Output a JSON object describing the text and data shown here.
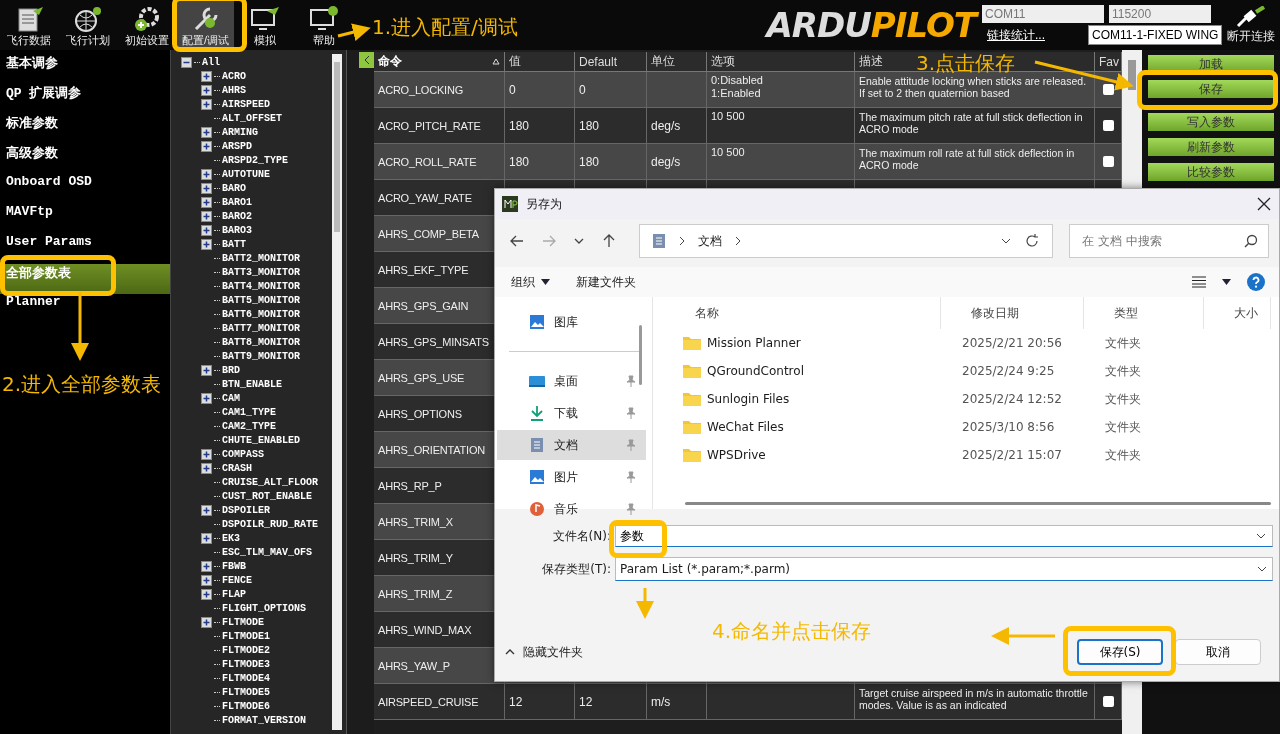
{
  "toolbar": {
    "items": [
      {
        "label": "飞行数据",
        "selected": false
      },
      {
        "label": "飞行计划",
        "selected": false
      },
      {
        "label": "初始设置",
        "selected": false
      },
      {
        "label": "配置/调试",
        "selected": true
      },
      {
        "label": "模拟",
        "selected": false
      },
      {
        "label": "帮助",
        "selected": false
      }
    ]
  },
  "logo": {
    "part_1": "ARDU",
    "part_2": "PILOT"
  },
  "connection": {
    "port": "COM11",
    "baud": "115200",
    "stats_link": "链接统计...",
    "vehicle": "COM11-1-FIXED WING",
    "disconnect": "断开连接"
  },
  "sidebar": {
    "items": [
      {
        "label": "基本调参",
        "selected": false
      },
      {
        "label": "QP 扩展调参",
        "selected": false
      },
      {
        "label": "标准参数",
        "selected": false
      },
      {
        "label": "高级参数",
        "selected": false
      },
      {
        "label": "Onboard OSD",
        "selected": false
      },
      {
        "label": "MAVFtp",
        "selected": false
      },
      {
        "label": "User Params",
        "selected": false
      },
      {
        "label": "全部参数表",
        "selected": true
      },
      {
        "label": "Planner",
        "selected": false
      }
    ]
  },
  "tree": {
    "label": "All",
    "kind": "group",
    "expanded": true,
    "children": [
      {
        "label": "ACRO",
        "kind": "group",
        "expanded": false
      },
      {
        "label": "AHRS",
        "kind": "group",
        "expanded": false
      },
      {
        "label": "AIRSPEED",
        "kind": "group",
        "expanded": false
      },
      {
        "label": "ALT_OFFSET",
        "kind": "leaf"
      },
      {
        "label": "ARMING",
        "kind": "group",
        "expanded": false
      },
      {
        "label": "ARSPD",
        "kind": "group",
        "expanded": false
      },
      {
        "label": "ARSPD2_TYPE",
        "kind": "leaf"
      },
      {
        "label": "AUTOTUNE",
        "kind": "group",
        "expanded": false
      },
      {
        "label": "BARO",
        "kind": "group",
        "expanded": false
      },
      {
        "label": "BARO1",
        "kind": "group",
        "expanded": false
      },
      {
        "label": "BARO2",
        "kind": "group",
        "expanded": false
      },
      {
        "label": "BARO3",
        "kind": "group",
        "expanded": false
      },
      {
        "label": "BATT",
        "kind": "group",
        "expanded": false
      },
      {
        "label": "BATT2_MONITOR",
        "kind": "leaf"
      },
      {
        "label": "BATT3_MONITOR",
        "kind": "leaf"
      },
      {
        "label": "BATT4_MONITOR",
        "kind": "leaf"
      },
      {
        "label": "BATT5_MONITOR",
        "kind": "leaf"
      },
      {
        "label": "BATT6_MONITOR",
        "kind": "leaf"
      },
      {
        "label": "BATT7_MONITOR",
        "kind": "leaf"
      },
      {
        "label": "BATT8_MONITOR",
        "kind": "leaf"
      },
      {
        "label": "BATT9_MONITOR",
        "kind": "leaf"
      },
      {
        "label": "BRD",
        "kind": "group",
        "expanded": false
      },
      {
        "label": "BTN_ENABLE",
        "kind": "leaf"
      },
      {
        "label": "CAM",
        "kind": "group",
        "expanded": false
      },
      {
        "label": "CAM1_TYPE",
        "kind": "leaf"
      },
      {
        "label": "CAM2_TYPE",
        "kind": "leaf"
      },
      {
        "label": "CHUTE_ENABLED",
        "kind": "leaf"
      },
      {
        "label": "COMPASS",
        "kind": "group",
        "expanded": false
      },
      {
        "label": "CRASH",
        "kind": "group",
        "expanded": false
      },
      {
        "label": "CRUISE_ALT_FLOOR",
        "kind": "leaf"
      },
      {
        "label": "CUST_ROT_ENABLE",
        "kind": "leaf"
      },
      {
        "label": "DSPOILER",
        "kind": "group",
        "expanded": false
      },
      {
        "label": "DSPOILR_RUD_RATE",
        "kind": "leaf"
      },
      {
        "label": "EK3",
        "kind": "group",
        "expanded": false
      },
      {
        "label": "ESC_TLM_MAV_OFS",
        "kind": "leaf"
      },
      {
        "label": "FBWB",
        "kind": "group",
        "expanded": false
      },
      {
        "label": "FENCE",
        "kind": "group",
        "expanded": false
      },
      {
        "label": "FLAP",
        "kind": "group",
        "expanded": false
      },
      {
        "label": "FLIGHT_OPTIONS",
        "kind": "leaf"
      },
      {
        "label": "FLTMODE",
        "kind": "group",
        "expanded": false
      },
      {
        "label": "FLTMODE1",
        "kind": "leaf"
      },
      {
        "label": "FLTMODE2",
        "kind": "leaf"
      },
      {
        "label": "FLTMODE3",
        "kind": "leaf"
      },
      {
        "label": "FLTMODE4",
        "kind": "leaf"
      },
      {
        "label": "FLTMODE5",
        "kind": "leaf"
      },
      {
        "label": "FLTMODE6",
        "kind": "leaf"
      },
      {
        "label": "FORMAT_VERSION",
        "kind": "leaf"
      }
    ]
  },
  "table": {
    "columns": [
      {
        "label": "命令",
        "sorted": true
      },
      {
        "label": "值",
        "sorted": false
      },
      {
        "label": "Default",
        "sorted": false
      },
      {
        "label": "单位",
        "sorted": false
      },
      {
        "label": "选项",
        "sorted": false
      },
      {
        "label": "描述",
        "sorted": false
      },
      {
        "label": "Fav",
        "sorted": false
      }
    ],
    "rows": [
      {
        "command": "ACRO_LOCKING",
        "value": "0",
        "default": "0",
        "options": [
          "0:Disabled",
          "1:Enabled"
        ],
        "description": "Enable attitude locking when sticks are released. If set to 2 then quaternion based",
        "fav": false
      },
      {
        "command": "ACRO_PITCH_RATE",
        "value": "180",
        "default": "180",
        "unit": "deg/s",
        "options": [
          "10 500"
        ],
        "description": "The maximum pitch rate at full stick deflection in ACRO mode",
        "fav": false
      },
      {
        "command": "ACRO_ROLL_RATE",
        "value": "180",
        "default": "180",
        "unit": "deg/s",
        "options": [
          "10 500"
        ],
        "description": "The maximum roll rate at full stick deflection in ACRO mode",
        "fav": false
      },
      {
        "command": "ACRO_YAW_RATE"
      },
      {
        "command": "AHRS_COMP_BETA"
      },
      {
        "command": "AHRS_EKF_TYPE"
      },
      {
        "command": "AHRS_GPS_GAIN"
      },
      {
        "command": "AHRS_GPS_MINSATS"
      },
      {
        "command": "AHRS_GPS_USE"
      },
      {
        "command": "AHRS_OPTIONS"
      },
      {
        "command": "AHRS_ORIENTATION"
      },
      {
        "command": "AHRS_RP_P"
      },
      {
        "command": "AHRS_TRIM_X"
      },
      {
        "command": "AHRS_TRIM_Y"
      },
      {
        "command": "AHRS_TRIM_Z"
      },
      {
        "command": "AHRS_WIND_MAX"
      },
      {
        "command": "AHRS_YAW_P"
      },
      {
        "command": "AIRSPEED_CRUISE",
        "value": "12",
        "default": "12",
        "unit": "m/s",
        "description": "Target cruise airspeed in m/s in automatic throttle modes. Value is as an indicated",
        "fav": false
      }
    ]
  },
  "actions": {
    "buttons": [
      "加载",
      "保存",
      "写入参数",
      "刷新参数",
      "比较参数"
    ]
  },
  "dialog": {
    "title": "另存为",
    "path": "文档",
    "search": {
      "placeholder": "在 文档 中搜索"
    },
    "toolbar": {
      "organize": "组织",
      "new_folder": "新建文件夹"
    },
    "nav_items": [
      {
        "label": "图库",
        "pinned": false,
        "selected": false
      },
      {
        "label": "桌面",
        "pinned": true,
        "selected": false
      },
      {
        "label": "下载",
        "pinned": true,
        "selected": false
      },
      {
        "label": "文档",
        "pinned": true,
        "selected": true
      },
      {
        "label": "图片",
        "pinned": true,
        "selected": false
      },
      {
        "label": "音乐",
        "pinned": true,
        "selected": false
      }
    ],
    "columns": [
      "名称",
      "修改日期",
      "类型",
      "大小"
    ],
    "files": [
      {
        "name": "Mission Planner",
        "modified": "2025/2/21 20:56",
        "type": "文件夹"
      },
      {
        "name": "QGroundControl",
        "modified": "2025/2/24 9:25",
        "type": "文件夹"
      },
      {
        "name": "Sunlogin Files",
        "modified": "2025/2/24 12:52",
        "type": "文件夹"
      },
      {
        "name": "WeChat Files",
        "modified": "2025/3/10 8:56",
        "type": "文件夹"
      },
      {
        "name": "WPSDrive",
        "modified": "2025/2/21 15:07",
        "type": "文件夹"
      }
    ],
    "filename_label": "文件名(N):",
    "filename": "参数",
    "filetype_label": "保存类型(T):",
    "filetype": "Param List (*.param;*.parm)",
    "hide_folders": "隐藏文件夹",
    "save": "保存(S)",
    "cancel": "取消"
  },
  "annotations": [
    {
      "text": "1.进入配置/调试"
    },
    {
      "text": "2.进入全部参数表"
    },
    {
      "text": "3.点击保存"
    },
    {
      "text": "4.命名并点击保存"
    }
  ]
}
